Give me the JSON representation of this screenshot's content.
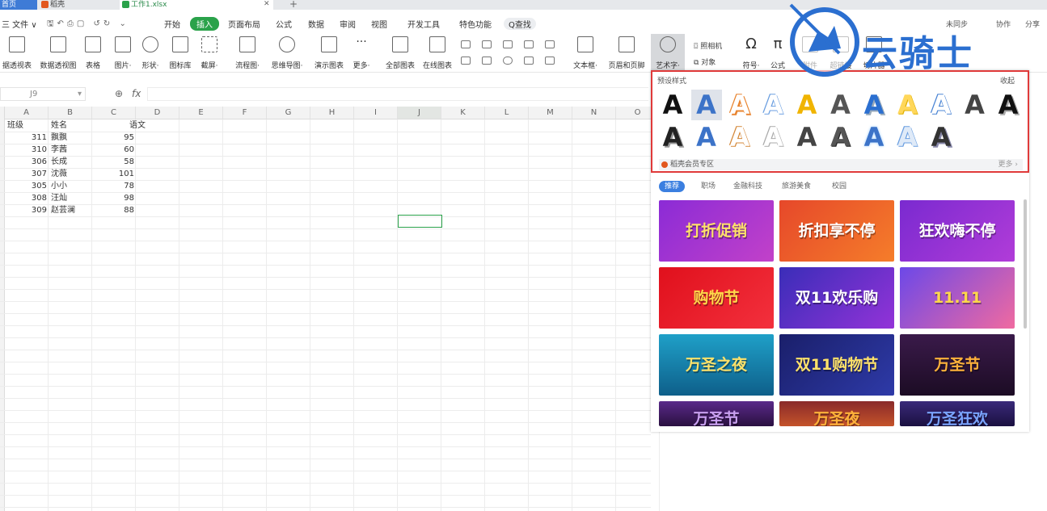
{
  "tabs": {
    "home": "首页",
    "docer": "稻壳",
    "file": "工作1.xlsx",
    "add": "+"
  },
  "menu": {
    "file": "三 文件 ∨",
    "items": [
      "开始",
      "插入",
      "页面布局",
      "公式",
      "数据",
      "审阅",
      "视图",
      "开发工具",
      "特色功能"
    ],
    "active": "插入",
    "search": "Q查找",
    "right": [
      "未同步",
      "协作",
      "分享"
    ]
  },
  "toolbar": {
    "buttons": [
      "据透视表",
      "数据透视图",
      "表格",
      "图片·",
      "形状·",
      "图标库",
      "截屏·",
      "流程图·",
      "思维导图·",
      "演示图表",
      "更多·",
      "全部图表",
      "在线图表",
      "文本框·",
      "页眉和页脚",
      "艺术字·",
      "符号·",
      "公式",
      "附件",
      "超链接",
      "切片器"
    ],
    "small": [
      "照相机",
      "对象"
    ]
  },
  "formula": {
    "cell_ref": "J9",
    "fx": "fx"
  },
  "sheet": {
    "columns": [
      "A",
      "B",
      "C",
      "D",
      "E",
      "F",
      "G",
      "H",
      "I",
      "J",
      "K",
      "L",
      "M",
      "N",
      "O"
    ],
    "headers": [
      "班级",
      "姓名",
      "语文"
    ],
    "rows": [
      [
        "311",
        "飘飘",
        "95"
      ],
      [
        "310",
        "李茜",
        "60"
      ],
      [
        "306",
        "长成",
        "58"
      ],
      [
        "307",
        "沈薇",
        "101"
      ],
      [
        "305",
        "小小",
        "78"
      ],
      [
        "308",
        "汪灿",
        "98"
      ],
      [
        "309",
        "赵芸澜",
        "88"
      ]
    ]
  },
  "panel": {
    "title": "预设样式",
    "collapse": "收起",
    "vip": "稻壳会员专区",
    "more": "更多 ›",
    "art_letter": "A",
    "categories": [
      "推荐",
      "职场",
      "金融科技",
      "旅游美食",
      "校园"
    ],
    "cards": [
      "打折促销",
      "折扣享不停",
      "狂欢嗨不停",
      "购物节",
      "双11欢乐购",
      "11.11",
      "万圣之夜",
      "双11购物节",
      "万圣节",
      "万圣节",
      "万圣夜",
      "万圣狂欢"
    ]
  },
  "watermark": {
    "text": "云骑士"
  },
  "colors": {
    "accent": "#2aa24a",
    "highlight": "#e03a3a",
    "brand": "#2b6fd0"
  }
}
